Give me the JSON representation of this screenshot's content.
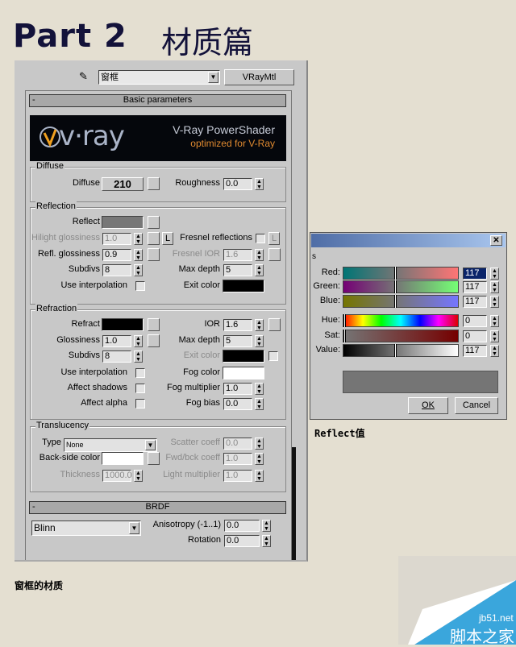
{
  "title": {
    "part": "Part 2",
    "chinese": "材质篇"
  },
  "material": {
    "name": "窗框",
    "type": "VRayMtl",
    "picker_icon": "eyedropper-icon"
  },
  "basic": {
    "collapse": "-",
    "header": "Basic parameters",
    "banner": {
      "logo": "v·ray",
      "line1": "V-Ray PowerShader",
      "line2": "optimized for V-Ray"
    }
  },
  "diffuse": {
    "group": "Diffuse",
    "label": "Diffuse",
    "value": "210",
    "roughness_label": "Roughness",
    "roughness": "0.0"
  },
  "reflection": {
    "group": "Reflection",
    "reflect_label": "Reflect",
    "reflect_color": "#777777",
    "hilight_label": "Hilight glossiness",
    "hilight": "1.0",
    "lock": "L",
    "fresnel_label": "Fresnel reflections",
    "fresnel_lock": "L",
    "gloss_label": "Refl. glossiness",
    "gloss": "0.9",
    "fresnel_ior_label": "Fresnel IOR",
    "fresnel_ior": "1.6",
    "subdivs_label": "Subdivs",
    "subdivs": "8",
    "maxdepth_label": "Max depth",
    "maxdepth": "5",
    "interp_label": "Use interpolation",
    "exit_label": "Exit color",
    "exit_color": "#000000"
  },
  "refraction": {
    "group": "Refraction",
    "refract_label": "Refract",
    "refract_color": "#000000",
    "ior_label": "IOR",
    "ior": "1.6",
    "gloss_label": "Glossiness",
    "gloss": "1.0",
    "maxdepth_label": "Max depth",
    "maxdepth": "5",
    "subdivs_label": "Subdivs",
    "subdivs": "8",
    "exit_label": "Exit color",
    "exit_color": "#000000",
    "interp_label": "Use interpolation",
    "fog_label": "Fog color",
    "fog_color": "#ffffff",
    "shadows_label": "Affect shadows",
    "fogmult_label": "Fog multiplier",
    "fogmult": "1.0",
    "alpha_label": "Affect alpha",
    "fogbias_label": "Fog bias",
    "fogbias": "0.0"
  },
  "translucency": {
    "group": "Translucency",
    "type_label": "Type",
    "type": "None",
    "back_label": "Back-side color",
    "back_color": "#ffffff",
    "scatter_label": "Scatter coeff",
    "scatter": "0.0",
    "fwd_label": "Fwd/bck coeff",
    "fwd": "1.0",
    "thick_label": "Thickness",
    "thick": "1000.0",
    "light_label": "Light multiplier",
    "light": "1.0"
  },
  "brdf": {
    "collapse": "-",
    "header": "BRDF",
    "type": "Blinn",
    "aniso_label": "Anisotropy (-1..1)",
    "aniso": "0.0",
    "rot_label": "Rotation",
    "rot": "0.0"
  },
  "caption": "窗框的材质",
  "color_dialog": {
    "title_fragment": "s",
    "close": "✕",
    "rows": [
      {
        "label": "Red:",
        "value": "117"
      },
      {
        "label": "Green:",
        "value": "117"
      },
      {
        "label": "Blue:",
        "value": "117"
      },
      {
        "label": "Hue:",
        "value": "0"
      },
      {
        "label": "Sat:",
        "value": "0"
      },
      {
        "label": "Value:",
        "value": "117"
      }
    ],
    "preview_color": "#757575",
    "ok": "OK",
    "cancel": "Cancel"
  },
  "dialog_caption": "Reflect值",
  "watermark": {
    "site": "jb51.net",
    "name": "脚本之家",
    "color": "#3aa6dc"
  }
}
